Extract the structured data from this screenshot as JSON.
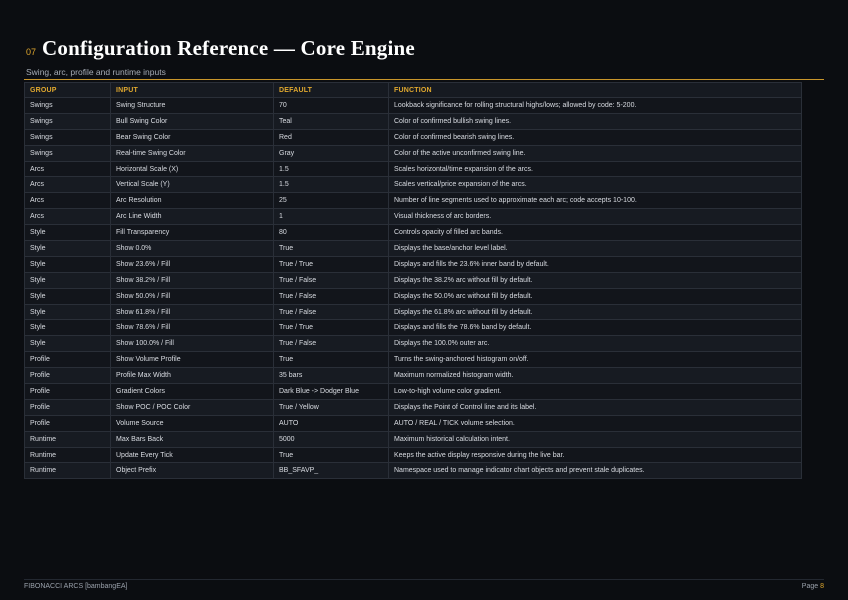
{
  "header": {
    "section_number": "07",
    "title": "Configuration Reference — Core Engine",
    "subtitle": "Swing, arc, profile and runtime inputs"
  },
  "table": {
    "columns": [
      "GROUP",
      "INPUT",
      "DEFAULT",
      "FUNCTION"
    ],
    "rows": [
      [
        "Swings",
        "Swing Structure",
        "70",
        "Lookback significance for rolling structural highs/lows; allowed by code: 5-200."
      ],
      [
        "Swings",
        "Bull Swing Color",
        "Teal",
        "Color of confirmed bullish swing lines."
      ],
      [
        "Swings",
        "Bear Swing Color",
        "Red",
        "Color of confirmed bearish swing lines."
      ],
      [
        "Swings",
        "Real-time Swing Color",
        "Gray",
        "Color of the active unconfirmed swing line."
      ],
      [
        "Arcs",
        "Horizontal Scale (X)",
        "1.5",
        "Scales horizontal/time expansion of the arcs."
      ],
      [
        "Arcs",
        "Vertical Scale (Y)",
        "1.5",
        "Scales vertical/price expansion of the arcs."
      ],
      [
        "Arcs",
        "Arc Resolution",
        "25",
        "Number of line segments used to approximate each arc; code accepts 10-100."
      ],
      [
        "Arcs",
        "Arc Line Width",
        "1",
        "Visual thickness of arc borders."
      ],
      [
        "Style",
        "Fill Transparency",
        "80",
        "Controls opacity of filled arc bands."
      ],
      [
        "Style",
        "Show 0.0%",
        "True",
        "Displays the base/anchor level label."
      ],
      [
        "Style",
        "Show 23.6% / Fill",
        "True / True",
        "Displays and fills the 23.6% inner band by default."
      ],
      [
        "Style",
        "Show 38.2% / Fill",
        "True / False",
        "Displays the 38.2% arc without fill by default."
      ],
      [
        "Style",
        "Show 50.0% / Fill",
        "True / False",
        "Displays the 50.0% arc without fill by default."
      ],
      [
        "Style",
        "Show 61.8% / Fill",
        "True / False",
        "Displays the 61.8% arc without fill by default."
      ],
      [
        "Style",
        "Show 78.6% / Fill",
        "True / True",
        "Displays and fills the 78.6% band by default."
      ],
      [
        "Style",
        "Show 100.0% / Fill",
        "True / False",
        "Displays the 100.0% outer arc."
      ],
      [
        "Profile",
        "Show Volume Profile",
        "True",
        "Turns the swing-anchored histogram on/off."
      ],
      [
        "Profile",
        "Profile Max Width",
        "35 bars",
        "Maximum normalized histogram width."
      ],
      [
        "Profile",
        "Gradient Colors",
        "Dark Blue -> Dodger Blue",
        "Low-to-high volume color gradient."
      ],
      [
        "Profile",
        "Show POC / POC Color",
        "True / Yellow",
        "Displays the Point of Control line and its label."
      ],
      [
        "Profile",
        "Volume Source",
        "AUTO",
        "AUTO / REAL / TICK volume selection."
      ],
      [
        "Runtime",
        "Max Bars Back",
        "5000",
        "Maximum historical calculation intent."
      ],
      [
        "Runtime",
        "Update Every Tick",
        "True",
        "Keeps the active display responsive during the live bar."
      ],
      [
        "Runtime",
        "Object Prefix",
        "BB_SFAVP_",
        "Namespace used to manage indicator chart objects and prevent stale duplicates."
      ]
    ]
  },
  "footer": {
    "left": "FIBONACCI ARCS [bambangEA]",
    "page_label": "Page",
    "page_number": "8"
  },
  "colors": {
    "accent": "#e0a82e",
    "background": "#0b0d11"
  }
}
